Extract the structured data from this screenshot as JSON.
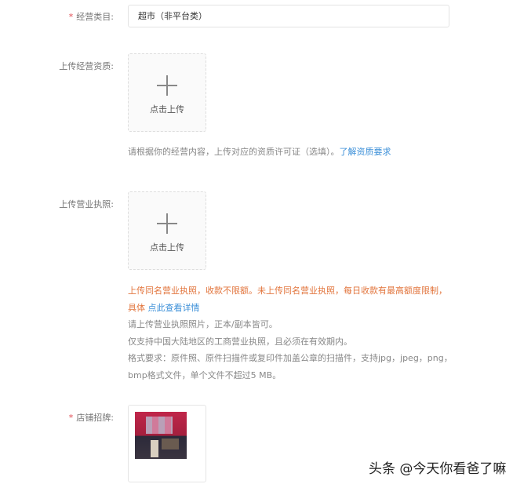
{
  "fields": {
    "category": {
      "required_mark": "*",
      "label": "经营类目:",
      "value": "超市（非平台类）"
    },
    "qualification": {
      "label": "上传经营资质:",
      "upload_label": "点击上传",
      "hint": "请根据你的经营内容，上传对应的资质许可证（选填）。",
      "hint_link": "了解资质要求"
    },
    "license": {
      "label": "上传营业执照:",
      "upload_label": "点击上传",
      "warning": "上传同名营业执照，收款不限额。未上传同名营业执照，每日收款有最高额度限制，具体 ",
      "warning_link": "点此查看详情",
      "notes": [
        "请上传营业执照照片，正本/副本皆可。",
        "仅支持中国大陆地区的工商营业执照，且必须在有效期内。",
        "格式要求：原件照、原件扫描件或复印件加盖公章的扫描件，支持jpg，jpeg，png，bmp格式文件，单个文件不超过5 MB。"
      ]
    },
    "shop_sign": {
      "required_mark": "*",
      "label": "店铺招牌:"
    }
  },
  "watermark": "头条 @今天你看爸了嘛",
  "colors": {
    "required": "#e0474f",
    "warning": "#e2753d",
    "link": "#3b8fd8"
  }
}
